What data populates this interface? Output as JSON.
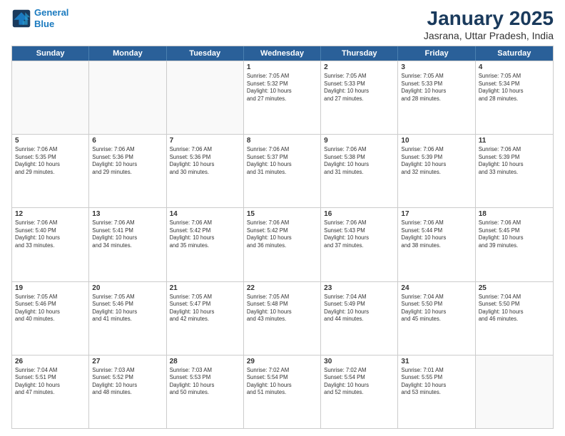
{
  "header": {
    "logo_line1": "General",
    "logo_line2": "Blue",
    "title": "January 2025",
    "subtitle": "Jasrana, Uttar Pradesh, India"
  },
  "weekdays": [
    "Sunday",
    "Monday",
    "Tuesday",
    "Wednesday",
    "Thursday",
    "Friday",
    "Saturday"
  ],
  "weeks": [
    [
      {
        "day": "",
        "info": ""
      },
      {
        "day": "",
        "info": ""
      },
      {
        "day": "",
        "info": ""
      },
      {
        "day": "1",
        "info": "Sunrise: 7:05 AM\nSunset: 5:32 PM\nDaylight: 10 hours\nand 27 minutes."
      },
      {
        "day": "2",
        "info": "Sunrise: 7:05 AM\nSunset: 5:33 PM\nDaylight: 10 hours\nand 27 minutes."
      },
      {
        "day": "3",
        "info": "Sunrise: 7:05 AM\nSunset: 5:33 PM\nDaylight: 10 hours\nand 28 minutes."
      },
      {
        "day": "4",
        "info": "Sunrise: 7:05 AM\nSunset: 5:34 PM\nDaylight: 10 hours\nand 28 minutes."
      }
    ],
    [
      {
        "day": "5",
        "info": "Sunrise: 7:06 AM\nSunset: 5:35 PM\nDaylight: 10 hours\nand 29 minutes."
      },
      {
        "day": "6",
        "info": "Sunrise: 7:06 AM\nSunset: 5:36 PM\nDaylight: 10 hours\nand 29 minutes."
      },
      {
        "day": "7",
        "info": "Sunrise: 7:06 AM\nSunset: 5:36 PM\nDaylight: 10 hours\nand 30 minutes."
      },
      {
        "day": "8",
        "info": "Sunrise: 7:06 AM\nSunset: 5:37 PM\nDaylight: 10 hours\nand 31 minutes."
      },
      {
        "day": "9",
        "info": "Sunrise: 7:06 AM\nSunset: 5:38 PM\nDaylight: 10 hours\nand 31 minutes."
      },
      {
        "day": "10",
        "info": "Sunrise: 7:06 AM\nSunset: 5:39 PM\nDaylight: 10 hours\nand 32 minutes."
      },
      {
        "day": "11",
        "info": "Sunrise: 7:06 AM\nSunset: 5:39 PM\nDaylight: 10 hours\nand 33 minutes."
      }
    ],
    [
      {
        "day": "12",
        "info": "Sunrise: 7:06 AM\nSunset: 5:40 PM\nDaylight: 10 hours\nand 33 minutes."
      },
      {
        "day": "13",
        "info": "Sunrise: 7:06 AM\nSunset: 5:41 PM\nDaylight: 10 hours\nand 34 minutes."
      },
      {
        "day": "14",
        "info": "Sunrise: 7:06 AM\nSunset: 5:42 PM\nDaylight: 10 hours\nand 35 minutes."
      },
      {
        "day": "15",
        "info": "Sunrise: 7:06 AM\nSunset: 5:42 PM\nDaylight: 10 hours\nand 36 minutes."
      },
      {
        "day": "16",
        "info": "Sunrise: 7:06 AM\nSunset: 5:43 PM\nDaylight: 10 hours\nand 37 minutes."
      },
      {
        "day": "17",
        "info": "Sunrise: 7:06 AM\nSunset: 5:44 PM\nDaylight: 10 hours\nand 38 minutes."
      },
      {
        "day": "18",
        "info": "Sunrise: 7:06 AM\nSunset: 5:45 PM\nDaylight: 10 hours\nand 39 minutes."
      }
    ],
    [
      {
        "day": "19",
        "info": "Sunrise: 7:05 AM\nSunset: 5:46 PM\nDaylight: 10 hours\nand 40 minutes."
      },
      {
        "day": "20",
        "info": "Sunrise: 7:05 AM\nSunset: 5:46 PM\nDaylight: 10 hours\nand 41 minutes."
      },
      {
        "day": "21",
        "info": "Sunrise: 7:05 AM\nSunset: 5:47 PM\nDaylight: 10 hours\nand 42 minutes."
      },
      {
        "day": "22",
        "info": "Sunrise: 7:05 AM\nSunset: 5:48 PM\nDaylight: 10 hours\nand 43 minutes."
      },
      {
        "day": "23",
        "info": "Sunrise: 7:04 AM\nSunset: 5:49 PM\nDaylight: 10 hours\nand 44 minutes."
      },
      {
        "day": "24",
        "info": "Sunrise: 7:04 AM\nSunset: 5:50 PM\nDaylight: 10 hours\nand 45 minutes."
      },
      {
        "day": "25",
        "info": "Sunrise: 7:04 AM\nSunset: 5:50 PM\nDaylight: 10 hours\nand 46 minutes."
      }
    ],
    [
      {
        "day": "26",
        "info": "Sunrise: 7:04 AM\nSunset: 5:51 PM\nDaylight: 10 hours\nand 47 minutes."
      },
      {
        "day": "27",
        "info": "Sunrise: 7:03 AM\nSunset: 5:52 PM\nDaylight: 10 hours\nand 48 minutes."
      },
      {
        "day": "28",
        "info": "Sunrise: 7:03 AM\nSunset: 5:53 PM\nDaylight: 10 hours\nand 50 minutes."
      },
      {
        "day": "29",
        "info": "Sunrise: 7:02 AM\nSunset: 5:54 PM\nDaylight: 10 hours\nand 51 minutes."
      },
      {
        "day": "30",
        "info": "Sunrise: 7:02 AM\nSunset: 5:54 PM\nDaylight: 10 hours\nand 52 minutes."
      },
      {
        "day": "31",
        "info": "Sunrise: 7:01 AM\nSunset: 5:55 PM\nDaylight: 10 hours\nand 53 minutes."
      },
      {
        "day": "",
        "info": ""
      }
    ]
  ]
}
